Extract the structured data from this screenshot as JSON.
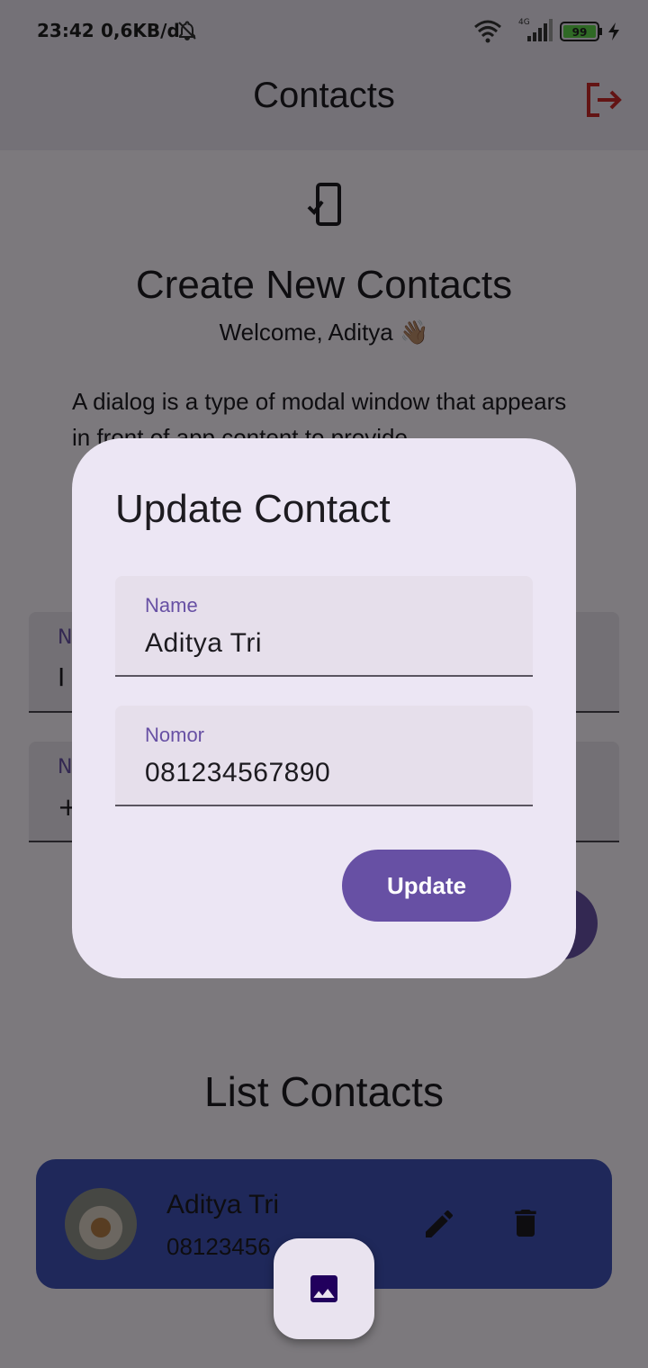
{
  "status_bar": {
    "time": "23:42",
    "network_speed": "0,6KB/d",
    "network_type": "4G",
    "battery": "99"
  },
  "app_bar": {
    "title": "Contacts"
  },
  "create_section": {
    "heading": "Create New Contacts",
    "welcome": "Welcome, Aditya 👋🏽",
    "description": "A dialog is a type of modal window that appears in front of app content to provide",
    "name_field": {
      "label": "N",
      "value": "I"
    },
    "number_field": {
      "label": "N",
      "value": "+"
    }
  },
  "list_section": {
    "heading": "List Contacts",
    "contacts": [
      {
        "name": "Aditya Tri",
        "number": "08123456"
      }
    ]
  },
  "dialog": {
    "title": "Update Contact",
    "name_label": "Name",
    "name_value": "Aditya Tri",
    "number_label": "Nomor",
    "number_value": "081234567890",
    "update_button": "Update"
  },
  "colors": {
    "primary": "#6750a4",
    "card": "#3f51b5",
    "logout": "#c62828"
  }
}
